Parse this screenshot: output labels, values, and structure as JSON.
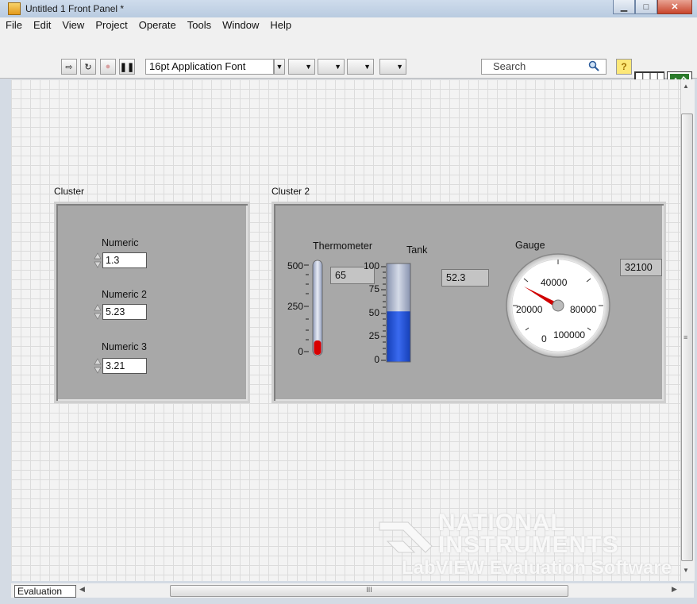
{
  "window": {
    "title": "Untitled 1 Front Panel *"
  },
  "menu": [
    "File",
    "Edit",
    "View",
    "Project",
    "Operate",
    "Tools",
    "Window",
    "Help"
  ],
  "toolbar": {
    "font": "16pt Application Font",
    "search_placeholder": "Search",
    "help_label": "?",
    "icon_number": "1"
  },
  "cluster1": {
    "label": "Cluster",
    "controls": [
      {
        "label": "Numeric",
        "value": "1.3"
      },
      {
        "label": "Numeric 2",
        "value": "5.23"
      },
      {
        "label": "Numeric 3",
        "value": "3.21"
      }
    ]
  },
  "cluster2": {
    "label": "Cluster 2",
    "thermometer": {
      "label": "Thermometer",
      "value": "65",
      "scale": [
        "500",
        "250",
        "0"
      ],
      "min": 0,
      "max": 500,
      "level": 65
    },
    "tank": {
      "label": "Tank",
      "value": "52.3",
      "scale": [
        "100",
        "75",
        "50",
        "25",
        "0"
      ],
      "min": 0,
      "max": 100,
      "level": 52.3
    },
    "gauge": {
      "label": "Gauge",
      "value": "32100",
      "scale": [
        "40000",
        "20000",
        "80000",
        "0",
        "100000"
      ]
    }
  },
  "watermark": {
    "line1": "NATIONAL",
    "line2": "INSTRUMENTS",
    "line3": "LabVIEW Evaluation Software"
  },
  "status": {
    "tab": "Evaluation",
    "hscroll_grip": "III"
  },
  "colors": {
    "thermo_fill": "#d90000",
    "tank_fill": "#1f4fd8",
    "needle": "#d00000",
    "panel": "#a8a8a8"
  }
}
